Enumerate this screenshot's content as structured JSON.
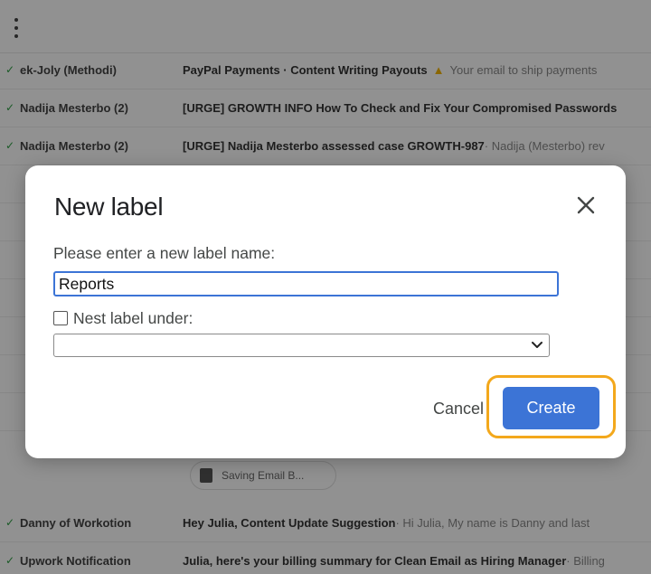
{
  "dialog": {
    "title": "New label",
    "prompt": "Please enter a new label name:",
    "label_name_value": "Reports",
    "nest_label": "Nest label under:",
    "nest_checked": false,
    "parent_selected": "",
    "cancel_label": "Cancel",
    "create_label": "Create"
  },
  "colors": {
    "primary": "#3c74d6",
    "focus_ring": "#f3a81c",
    "scrim": "rgba(0,0,0,0.43)"
  },
  "inbox": {
    "rows": [
      {
        "sender": "ek-Joly (Methodi)",
        "subject": "PayPal Payments · Content Writing Payouts",
        "snippet": "Your email to ship payments"
      },
      {
        "sender": "Nadija Mesterbo (2)",
        "subject": "[URGE] GROWTH INFO How To Check and Fix Your Compromised Passwords",
        "snippet": ""
      },
      {
        "sender": "Nadija Mesterbo (2)",
        "subject": "[URGE] Nadija Mesterbo assessed case GROWTH-987",
        "snippet": "· Nadija (Mesterbo) rev"
      },
      {
        "sender": "Danny of Workotion",
        "subject": "Hey Julia, Content Update Suggestion",
        "snippet": "· Hi Julia, My name is Danny and last"
      },
      {
        "sender": "Upwork Notification",
        "subject": "Julia, here's your billing summary for Clean Email as Hiring Manager",
        "snippet": "· Billing"
      }
    ],
    "chip_label": "Saving Email B..."
  }
}
